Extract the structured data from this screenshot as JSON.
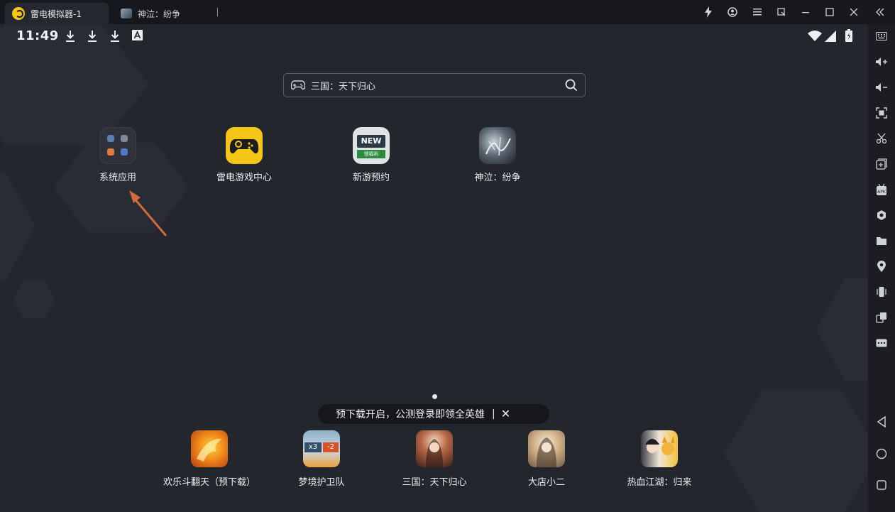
{
  "titlebar": {
    "tabs": [
      {
        "label": "雷电模拟器-1",
        "active": true
      },
      {
        "label": "神泣：纷争",
        "active": false
      }
    ],
    "controls": [
      "lightning-icon",
      "account-icon",
      "menu-icon",
      "restore-window-icon",
      "minimize-icon",
      "maximize-icon",
      "close-icon",
      "collapse-sidebar-icon"
    ]
  },
  "status_bar": {
    "time": "11:49",
    "left_icons": [
      "download-icon",
      "download-icon",
      "download-icon",
      "a-icon"
    ],
    "right_icons": [
      "wifi-icon",
      "signal-icon",
      "battery-icon"
    ]
  },
  "search": {
    "text": "三国：天下归心"
  },
  "desktop_apps": [
    {
      "label": "系统应用",
      "icon": "system-apps-folder-icon"
    },
    {
      "label": "雷电游戏中心",
      "icon": "game-center-icon"
    },
    {
      "label": "新游预约",
      "icon": "new-games-icon",
      "badge": "NEW",
      "strip": "领福利"
    },
    {
      "label": "神泣：纷争",
      "icon": "shenqi-game-icon"
    }
  ],
  "page_indicator": {
    "pages": 1,
    "current": 1
  },
  "banner": {
    "text": "预下载开启，公测登录即领全英雄",
    "separator": "|",
    "close": "✕"
  },
  "dock_apps": [
    {
      "label": "欢乐斗翻天（预下载）",
      "icon": "game-icon"
    },
    {
      "label": "梦境护卫队",
      "icon": "game-icon"
    },
    {
      "label": "三国：天下归心",
      "icon": "game-icon"
    },
    {
      "label": "大店小二",
      "icon": "game-icon"
    },
    {
      "label": "热血江湖：归来",
      "icon": "game-icon"
    }
  ],
  "sidebar": {
    "buttons": [
      "keyboard-icon",
      "volume-up-icon",
      "volume-down-icon",
      "screenshot-icon",
      "scissors-icon",
      "add-window-icon",
      "apk-icon",
      "settings-hex-icon",
      "folder-icon",
      "location-icon",
      "shake-icon",
      "multi-instance-icon",
      "more-icon",
      "back-icon",
      "home-icon",
      "recents-icon"
    ]
  },
  "colors": {
    "accent": "#f5c518",
    "arrow": "#d26a3a",
    "background": "#24262e"
  }
}
